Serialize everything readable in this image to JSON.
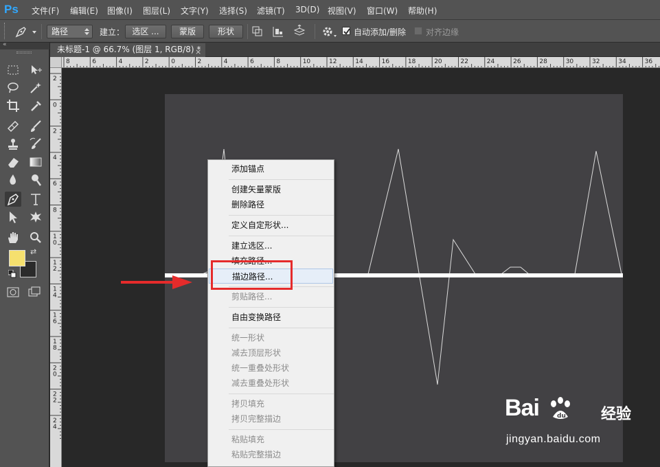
{
  "app": {
    "logo": "Ps"
  },
  "menubar": {
    "items": [
      "文件(F)",
      "编辑(E)",
      "图像(I)",
      "图层(L)",
      "文字(Y)",
      "选择(S)",
      "滤镜(T)",
      "3D(D)",
      "视图(V)",
      "窗口(W)",
      "帮助(H)"
    ]
  },
  "options": {
    "mode_value": "路径",
    "build_label": "建立：",
    "selection_button": "选区 ...",
    "mask_button": "蒙版",
    "shape_button": "形状",
    "auto_add_delete_label": "自动添加/删除",
    "auto_add_delete_checked": true,
    "align_edges_label": "对齐边缘",
    "align_edges_checked": false
  },
  "document": {
    "tab_title": "未标题-1 @ 66.7% (图层 1, RGB/8) *",
    "close_glyph": "×",
    "h_ruler_labels": [
      "8",
      "6",
      "4",
      "2",
      "0",
      "2",
      "4",
      "6",
      "8",
      "10",
      "12",
      "14",
      "16",
      "18",
      "20",
      "22",
      "24",
      "26",
      "28",
      "30",
      "32",
      "34",
      "36"
    ],
    "v_ruler_labels": [
      "2",
      "0",
      "2",
      "4",
      "6",
      "8",
      "10",
      "12",
      "14",
      "16",
      "18",
      "20",
      "22",
      "24"
    ]
  },
  "context_menu": {
    "items": [
      {
        "label": "添加锚点",
        "enabled": true
      },
      {
        "label": "创建矢量蒙版",
        "enabled": true
      },
      {
        "label": "删除路径",
        "enabled": true
      },
      {
        "label": "定义自定形状...",
        "enabled": true
      },
      {
        "label": "建立选区...",
        "enabled": true
      },
      {
        "label": "填充路径...",
        "enabled": true
      },
      {
        "label": "描边路径...",
        "enabled": true,
        "highlighted": true
      },
      {
        "label": "剪贴路径...",
        "enabled": false
      },
      {
        "label": "自由变换路径",
        "enabled": true
      },
      {
        "label": "统一形状",
        "enabled": false
      },
      {
        "label": "减去顶层形状",
        "enabled": false
      },
      {
        "label": "统一重叠处形状",
        "enabled": false
      },
      {
        "label": "减去重叠处形状",
        "enabled": false
      },
      {
        "label": "拷贝填充",
        "enabled": false
      },
      {
        "label": "拷贝完整描边",
        "enabled": false
      },
      {
        "label": "粘贴填充",
        "enabled": false
      },
      {
        "label": "粘贴完整描边",
        "enabled": false
      }
    ]
  },
  "colors": {
    "foreground": "#f5e06e",
    "background": "#2b2b2b",
    "annotation_red": "#e52b2b",
    "canvas_bg": "#424144"
  },
  "watermark": {
    "brand_left": "Bai",
    "brand_right": "经验",
    "url": "jingyan.baidu.com"
  }
}
